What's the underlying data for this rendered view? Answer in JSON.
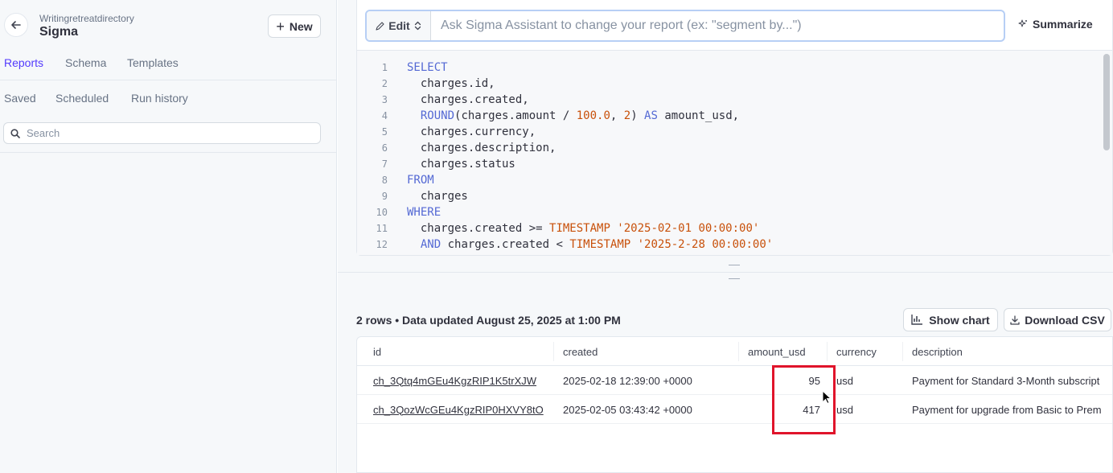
{
  "sidebar": {
    "parent_label": "Writingretreatdirectory",
    "app_name": "Sigma",
    "new_label": "New",
    "tabs": [
      {
        "label": "Reports",
        "active": true
      },
      {
        "label": "Schema",
        "active": false
      },
      {
        "label": "Templates",
        "active": false
      }
    ],
    "subtabs": [
      {
        "label": "Saved"
      },
      {
        "label": "Scheduled"
      },
      {
        "label": "Run history"
      }
    ],
    "search_placeholder": "Search"
  },
  "assistant": {
    "mode_label": "Edit",
    "placeholder": "Ask Sigma Assistant to change your report (ex: \"segment by...\")",
    "summarize_label": "Summarize"
  },
  "editor": {
    "line_numbers": [
      "1",
      "2",
      "3",
      "4",
      "5",
      "6",
      "7",
      "8",
      "9",
      "10",
      "11",
      "12"
    ]
  },
  "results": {
    "status": "2 rows • Data updated August 25, 2025 at 1:00 PM",
    "show_chart_label": "Show chart",
    "download_label": "Download CSV",
    "columns": [
      "id",
      "created",
      "amount_usd",
      "currency",
      "description"
    ],
    "rows": [
      {
        "id": "ch_3Qtq4mGEu4KgzRIP1K5trXJW",
        "created": "2025-02-18 12:39:00 +0000",
        "amount_usd": "95",
        "currency": "usd",
        "description": "Payment for Standard 3-Month subscript"
      },
      {
        "id": "ch_3QozWcGEu4KgzRIP0HXVY8tO",
        "created": "2025-02-05 03:43:42 +0000",
        "amount_usd": "417",
        "currency": "usd",
        "description": "Payment for upgrade from Basic to Prem"
      }
    ]
  },
  "colors": {
    "accent": "#533afd",
    "highlight": "#e0142b",
    "keyword": "#5469d4",
    "string": "#c8500a"
  }
}
